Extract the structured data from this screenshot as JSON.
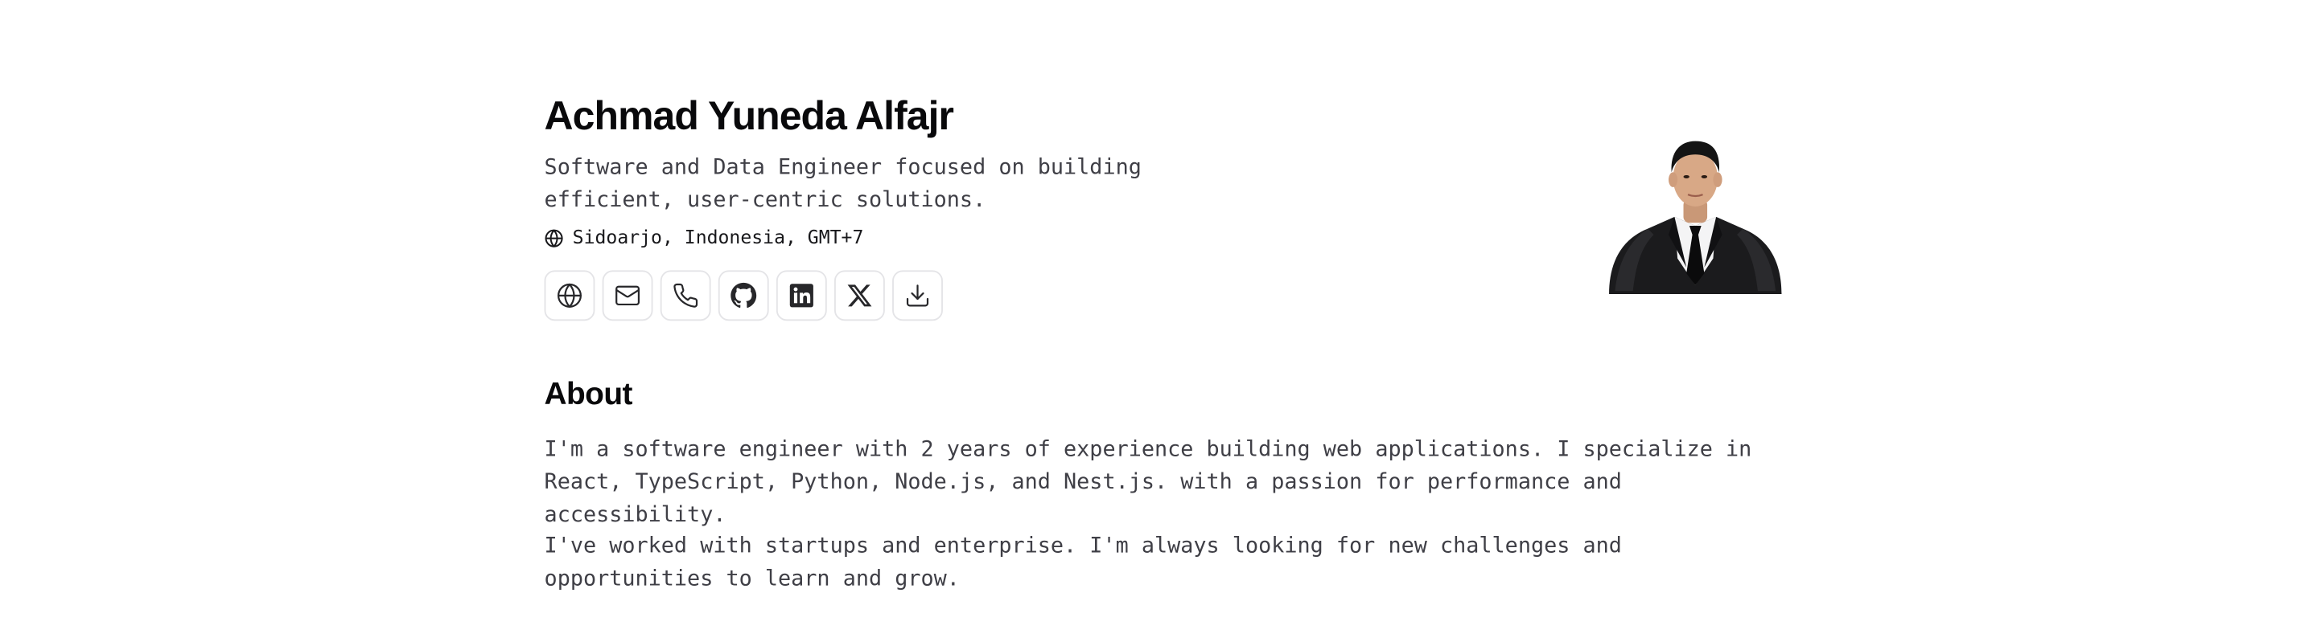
{
  "profile": {
    "name": "Achmad Yuneda Alfajr",
    "tagline": "Software and Data Engineer focused on building efficient, user-centric solutions.",
    "location": "Sidoarjo, Indonesia, GMT+7",
    "location_icon": "globe-icon"
  },
  "socials": [
    {
      "icon": "globe-icon"
    },
    {
      "icon": "mail-icon"
    },
    {
      "icon": "phone-icon"
    },
    {
      "icon": "github-icon"
    },
    {
      "icon": "linkedin-icon"
    },
    {
      "icon": "x-icon"
    },
    {
      "icon": "download-icon"
    }
  ],
  "about": {
    "heading": "About",
    "paragraph_1": "I'm a software engineer with 2 years of experience building web applications. I specialize in React, TypeScript, Python, Node.js, and Nest.js. with a passion for performance and accessibility.",
    "paragraph_2": "I've worked with startups and enterprise. I'm always looking for new challenges and opportunities to learn and grow."
  },
  "colors": {
    "text_primary": "#09090b",
    "text_secondary": "#3f3f46",
    "border": "#e4e4e7",
    "background": "#ffffff"
  }
}
